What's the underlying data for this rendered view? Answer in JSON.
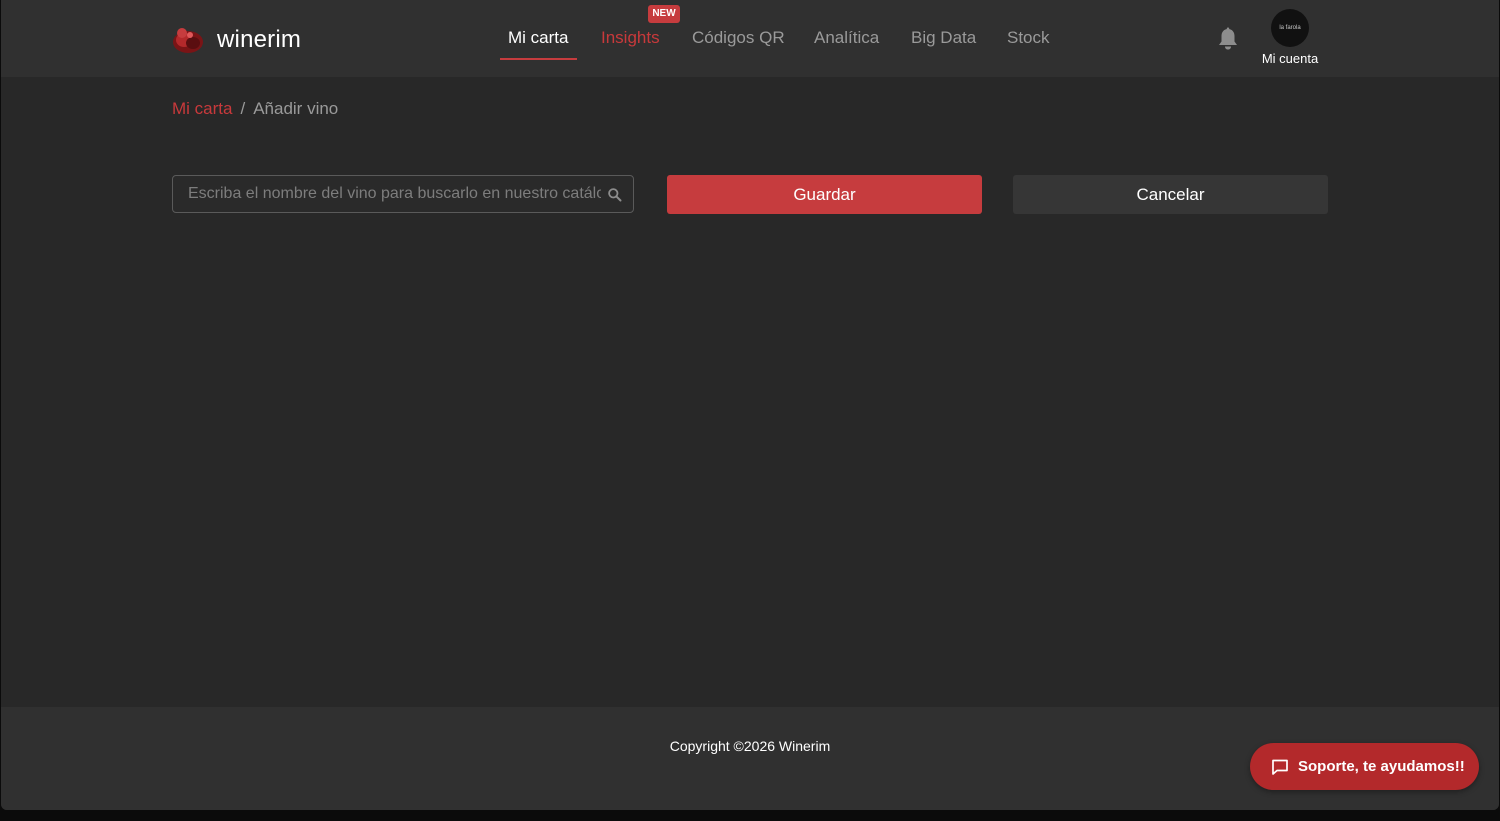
{
  "brand": {
    "name": "winerim",
    "accent_color": "#c63c3e"
  },
  "nav": {
    "items": [
      {
        "label": "Mi carta",
        "state": "active"
      },
      {
        "label": "Insights",
        "state": "highlight",
        "badge": "NEW"
      },
      {
        "label": "Códigos QR",
        "state": "normal"
      },
      {
        "label": "Analítica",
        "state": "normal"
      },
      {
        "label": "Big Data",
        "state": "normal"
      },
      {
        "label": "Stock",
        "state": "normal"
      }
    ]
  },
  "header": {
    "notifications_icon": "bell-icon",
    "account": {
      "avatar_text": "la farola",
      "label": "Mi cuenta"
    }
  },
  "breadcrumb": {
    "parent": "Mi carta",
    "separator": "/",
    "current": "Añadir vino"
  },
  "form": {
    "search": {
      "value": "",
      "placeholder": "Escriba el nombre del vino para buscarlo en nuestro catálogo",
      "icon": "search-icon"
    },
    "save_label": "Guardar",
    "cancel_label": "Cancelar"
  },
  "footer": {
    "copyright": "Copyright ©2026 Winerim"
  },
  "support": {
    "label": "Soporte, te ayudamos!!",
    "icon": "chat-icon"
  }
}
